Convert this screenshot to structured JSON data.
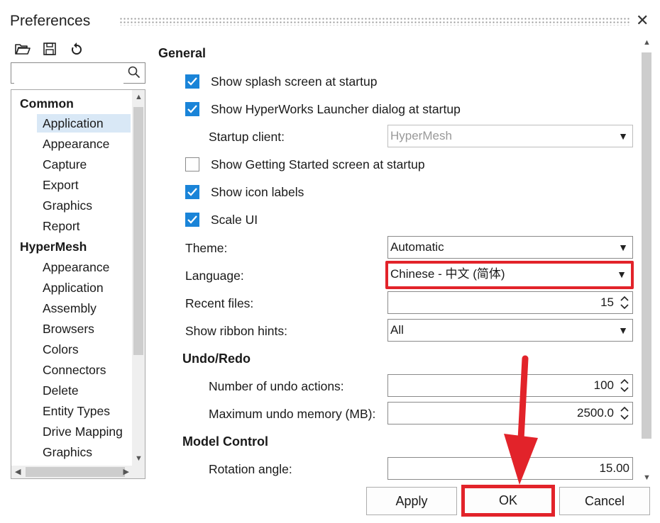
{
  "window": {
    "title": "Preferences"
  },
  "search": {
    "placeholder": ""
  },
  "tree": {
    "groups": [
      {
        "label": "Common",
        "items": [
          "Application",
          "Appearance",
          "Capture",
          "Export",
          "Graphics",
          "Report"
        ]
      },
      {
        "label": "HyperMesh",
        "items": [
          "Appearance",
          "Application",
          "Assembly",
          "Browsers",
          "Colors",
          "Connectors",
          "Delete",
          "Entity Types",
          "Drive Mapping",
          "Graphics"
        ]
      }
    ],
    "selected": "Application"
  },
  "general": {
    "heading": "General",
    "splash": {
      "label": "Show splash screen at startup",
      "checked": true
    },
    "launcher": {
      "label": "Show HyperWorks Launcher dialog at startup",
      "checked": true
    },
    "startup_client": {
      "label": "Startup client:",
      "value": "HyperMesh"
    },
    "getting_started": {
      "label": "Show Getting Started screen at startup",
      "checked": false
    },
    "icon_labels": {
      "label": "Show icon labels",
      "checked": true
    },
    "scale_ui": {
      "label": "Scale UI",
      "checked": true
    },
    "theme": {
      "label": "Theme:",
      "value": "Automatic"
    },
    "language": {
      "label": "Language:",
      "value": "Chinese - 中文 (简体)"
    },
    "recent_files": {
      "label": "Recent files:",
      "value": "15"
    },
    "ribbon_hints": {
      "label": "Show ribbon hints:",
      "value": "All"
    }
  },
  "undo": {
    "heading": "Undo/Redo",
    "actions": {
      "label": "Number of undo actions:",
      "value": "100"
    },
    "memory": {
      "label": "Maximum undo memory (MB):",
      "value": "2500.0"
    }
  },
  "model": {
    "heading": "Model Control",
    "rotation": {
      "label": "Rotation angle:",
      "value": "15.00"
    }
  },
  "buttons": {
    "apply": "Apply",
    "ok": "OK",
    "cancel": "Cancel"
  },
  "colors": {
    "accent": "#1a84d8",
    "highlight": "#e2232a"
  }
}
